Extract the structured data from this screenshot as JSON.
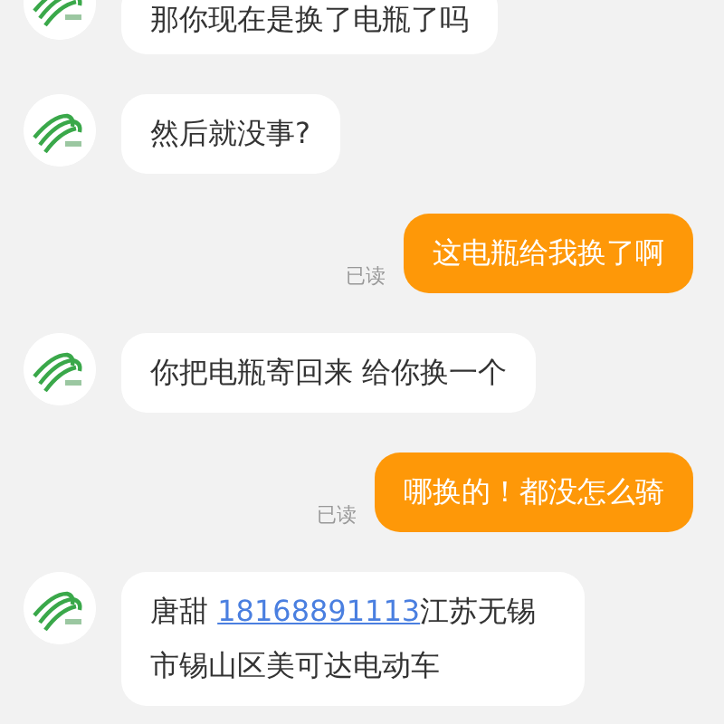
{
  "messages": [
    {
      "kind": "incoming",
      "parts": [
        {
          "kind": "text",
          "text": "那你现在是换了电瓶了吗"
        }
      ]
    },
    {
      "kind": "incoming",
      "parts": [
        {
          "kind": "text",
          "text": "然后就没事?"
        }
      ]
    },
    {
      "kind": "outgoing",
      "parts": [
        {
          "kind": "text",
          "text": "这电瓶给我换了啊"
        }
      ],
      "status": "已读"
    },
    {
      "kind": "incoming",
      "parts": [
        {
          "kind": "text",
          "text": "你把电瓶寄回来 给你换一个"
        }
      ]
    },
    {
      "kind": "outgoing",
      "parts": [
        {
          "kind": "text",
          "text": "哪换的！都没怎么骑"
        }
      ],
      "status": "已读"
    },
    {
      "kind": "incoming",
      "parts": [
        {
          "kind": "text",
          "text": "唐甜  "
        },
        {
          "kind": "phone",
          "text": "18168891113"
        },
        {
          "kind": "text",
          "text": "江苏无锡市锡山区美可达电动车"
        }
      ]
    }
  ]
}
